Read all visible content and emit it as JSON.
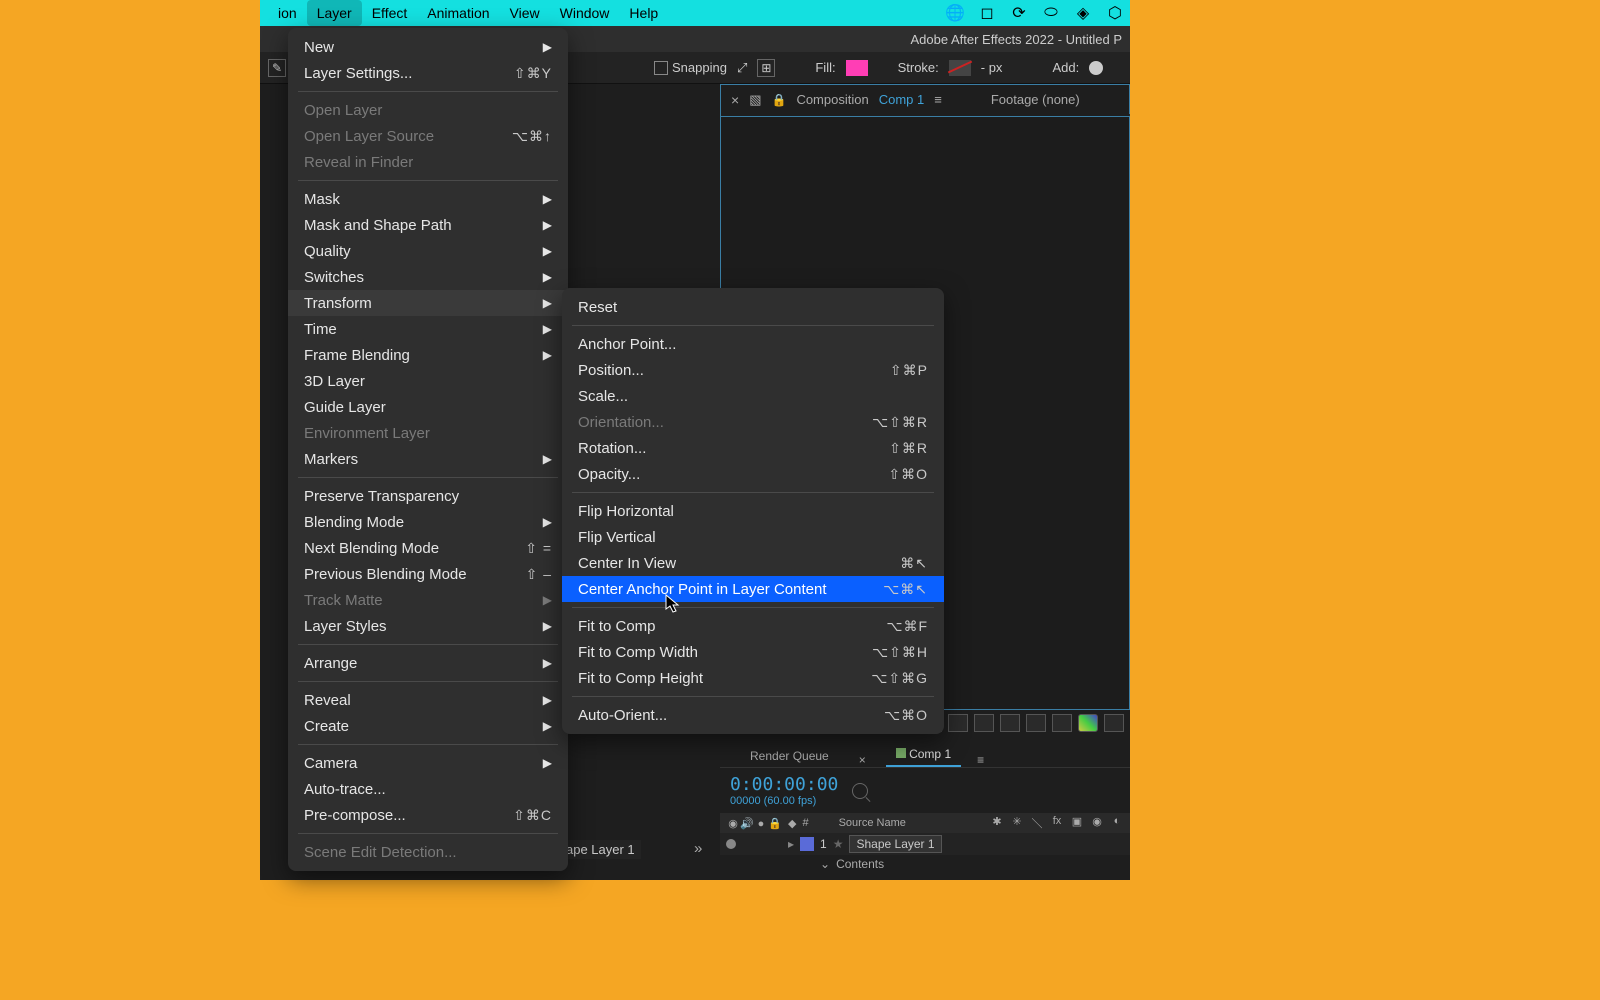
{
  "menubar": {
    "items": [
      "ion",
      "Layer",
      "Effect",
      "Animation",
      "View",
      "Window",
      "Help"
    ],
    "active_index": 1
  },
  "titlebar": "Adobe After Effects 2022 - Untitled P",
  "toolbar": {
    "snapping": "Snapping",
    "fill_label": "Fill:",
    "stroke_label": "Stroke:",
    "stroke_px": "- px",
    "add_label": "Add:"
  },
  "composition_panel": {
    "header_prefix": "Composition",
    "header_name": "Comp 1",
    "footage": "Footage (none)",
    "tab": "Comp 1"
  },
  "timeline": {
    "tabs": {
      "render_queue": "Render Queue",
      "comp": "Comp 1"
    },
    "timecode": "0:00:00:00",
    "timecode_sub": "00000 (60.00 fps)",
    "source_name_header": "Source Name",
    "layer": {
      "index": "1",
      "name": "Shape Layer 1",
      "also": "ape Layer 1"
    },
    "contents": "Contents"
  },
  "layer_menu": [
    {
      "label": "New",
      "arrow": true
    },
    {
      "label": "Layer Settings...",
      "shortcut": "⇧⌘Y"
    },
    {
      "sep": true
    },
    {
      "label": "Open Layer",
      "disabled": true
    },
    {
      "label": "Open Layer Source",
      "shortcut": "⌥⌘↑",
      "disabled": true
    },
    {
      "label": "Reveal in Finder",
      "disabled": true
    },
    {
      "sep": true
    },
    {
      "label": "Mask",
      "arrow": true
    },
    {
      "label": "Mask and Shape Path",
      "arrow": true
    },
    {
      "label": "Quality",
      "arrow": true
    },
    {
      "label": "Switches",
      "arrow": true
    },
    {
      "label": "Transform",
      "arrow": true,
      "hover": true
    },
    {
      "label": "Time",
      "arrow": true
    },
    {
      "label": "Frame Blending",
      "arrow": true
    },
    {
      "label": "3D Layer"
    },
    {
      "label": "Guide Layer"
    },
    {
      "label": "Environment Layer",
      "disabled": true
    },
    {
      "label": "Markers",
      "arrow": true
    },
    {
      "sep": true
    },
    {
      "label": "Preserve Transparency"
    },
    {
      "label": "Blending Mode",
      "arrow": true
    },
    {
      "label": "Next Blending Mode",
      "shortcut": "⇧ ="
    },
    {
      "label": "Previous Blending Mode",
      "shortcut": "⇧ –"
    },
    {
      "label": "Track Matte",
      "arrow": true,
      "disabled": true
    },
    {
      "label": "Layer Styles",
      "arrow": true
    },
    {
      "sep": true
    },
    {
      "label": "Arrange",
      "arrow": true
    },
    {
      "sep": true
    },
    {
      "label": "Reveal",
      "arrow": true
    },
    {
      "label": "Create",
      "arrow": true
    },
    {
      "sep": true
    },
    {
      "label": "Camera",
      "arrow": true
    },
    {
      "label": "Auto-trace..."
    },
    {
      "label": "Pre-compose...",
      "shortcut": "⇧⌘C"
    },
    {
      "sep": true
    },
    {
      "label": "Scene Edit Detection...",
      "disabled": true
    }
  ],
  "transform_menu": [
    {
      "label": "Reset"
    },
    {
      "sep": true
    },
    {
      "label": "Anchor Point..."
    },
    {
      "label": "Position...",
      "shortcut": "⇧⌘P"
    },
    {
      "label": "Scale..."
    },
    {
      "label": "Orientation...",
      "shortcut": "⌥⇧⌘R",
      "disabled": true
    },
    {
      "label": "Rotation...",
      "shortcut": "⇧⌘R"
    },
    {
      "label": "Opacity...",
      "shortcut": "⇧⌘O"
    },
    {
      "sep": true
    },
    {
      "label": "Flip Horizontal"
    },
    {
      "label": "Flip Vertical"
    },
    {
      "label": "Center In View",
      "shortcut": "⌘↖"
    },
    {
      "label": "Center Anchor Point in Layer Content",
      "shortcut": "⌥⌘↖",
      "hl": true
    },
    {
      "sep": true
    },
    {
      "label": "Fit to Comp",
      "shortcut": "⌥⌘F"
    },
    {
      "label": "Fit to Comp Width",
      "shortcut": "⌥⇧⌘H"
    },
    {
      "label": "Fit to Comp Height",
      "shortcut": "⌥⇧⌘G"
    },
    {
      "sep": true
    },
    {
      "label": "Auto-Orient...",
      "shortcut": "⌥⌘O"
    }
  ]
}
